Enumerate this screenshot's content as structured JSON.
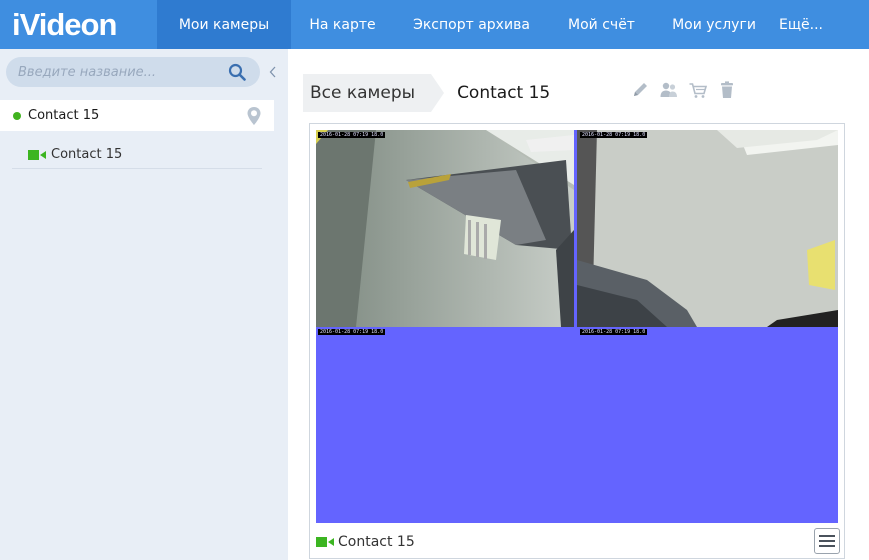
{
  "app": {
    "logo": "iVideon"
  },
  "nav": {
    "items": [
      {
        "label": "Мои камеры",
        "active": true
      },
      {
        "label": "На карте"
      },
      {
        "label": "Экспорт архива"
      },
      {
        "label": "Мой счёт"
      },
      {
        "label": "Мои услуги"
      },
      {
        "label": "Ещё..."
      }
    ]
  },
  "sidebar": {
    "search_placeholder": "Введите название...",
    "account": {
      "label": "Contact 15",
      "status_color": "#41b31f"
    },
    "cameras": [
      {
        "label": "Contact 15"
      }
    ]
  },
  "breadcrumb": {
    "all": "Все камеры",
    "current": "Contact 15"
  },
  "toolbar": {
    "icons": [
      "pencil-icon",
      "users-icon",
      "cart-icon",
      "trash-icon"
    ]
  },
  "player": {
    "camera_label": "Contact 15",
    "background_color": "#6464ff",
    "timestamps": [
      "2016-01-28 07:19 18.0",
      "2016-01-28 07:19 18.0",
      "2016-01-28 07:19 18.0",
      "2016-01-28 07:19 18.0"
    ]
  },
  "colors": {
    "accent": "#3f8ee0",
    "active_nav": "#2f7bd0",
    "sidebar_bg": "#e8eef6",
    "camera_green": "#3cb521"
  }
}
